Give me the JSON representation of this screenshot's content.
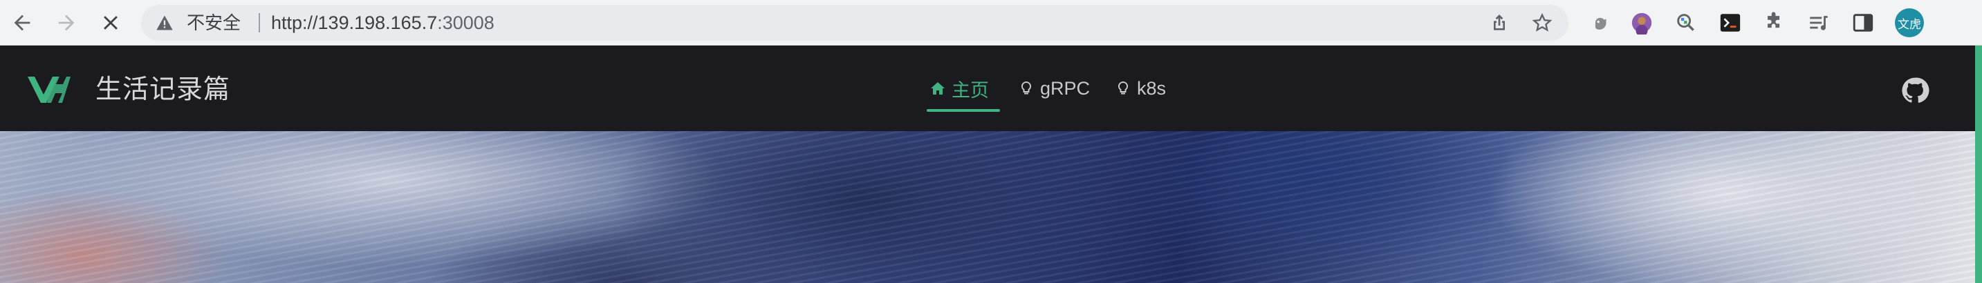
{
  "browser": {
    "security_label": "不安全",
    "url_host": "http://139.198.165.7",
    "url_rest": ":30008",
    "profile_initials": "文虎"
  },
  "site": {
    "title": "生活记录篇",
    "brand_color": "#3fb382",
    "nav": [
      {
        "label": "主页",
        "icon": "home-icon",
        "active": true
      },
      {
        "label": "gRPC",
        "icon": "lightbulb-icon",
        "active": false
      },
      {
        "label": "k8s",
        "icon": "lightbulb-icon",
        "active": false
      }
    ],
    "social_icon": "github-icon"
  }
}
